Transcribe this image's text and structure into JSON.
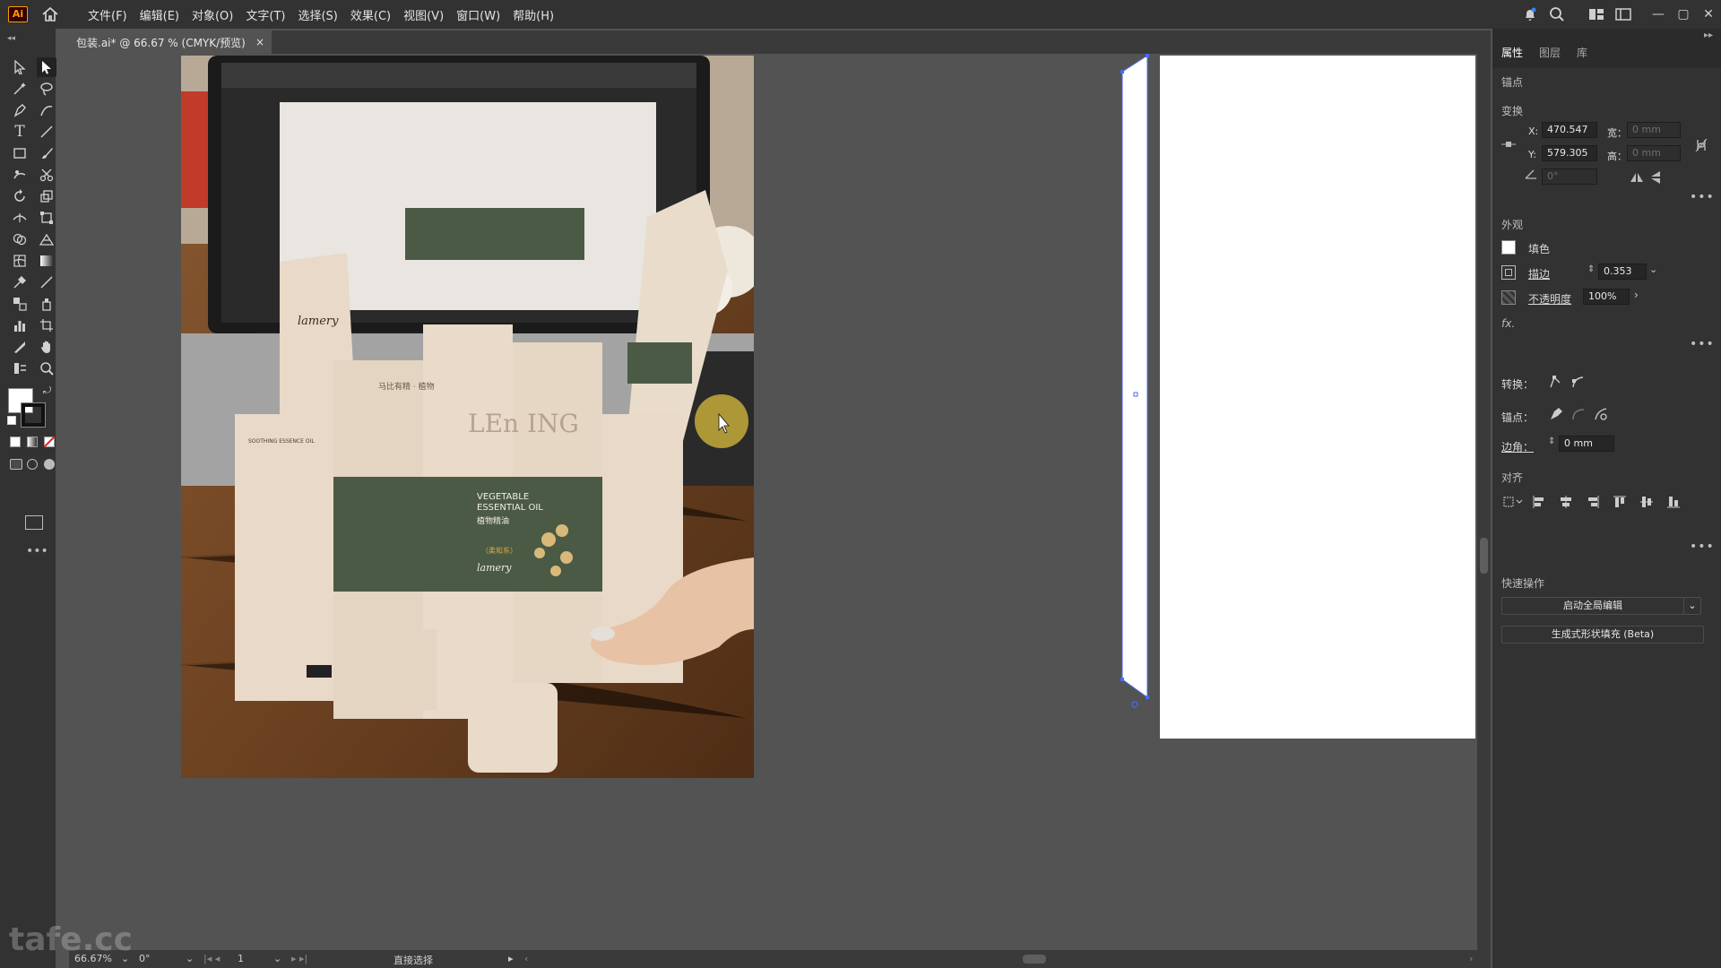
{
  "app": {
    "logo_text": "Ai"
  },
  "menu": [
    "文件(F)",
    "编辑(E)",
    "对象(O)",
    "文字(T)",
    "选择(S)",
    "效果(C)",
    "视图(V)",
    "窗口(W)",
    "帮助(H)"
  ],
  "window_controls": {
    "minimize": "—",
    "restore": "▢",
    "close": "✕"
  },
  "document_tab": {
    "title": "包装.ai* @ 66.67 % (CMYK/预览)",
    "close": "×"
  },
  "panel": {
    "tabs": [
      "属性",
      "图层",
      "库"
    ],
    "selection_type": "锚点",
    "transform": {
      "title": "变换",
      "x_label": "X:",
      "x_value": "470.547",
      "y_label": "Y:",
      "y_value": "579.305",
      "w_label": "宽：",
      "w_value": "0 mm",
      "h_label": "高：",
      "h_value": "0 mm",
      "angle_value": "0°"
    },
    "appearance": {
      "title": "外观",
      "fill_label": "填色",
      "stroke_label": "描边",
      "stroke_value": "0.353",
      "opacity_label": "不透明度",
      "opacity_value": "100%",
      "fx_label": "fx."
    },
    "convert_label": "转换：",
    "anchor_label": "锚点：",
    "corner_label": "边角：",
    "corner_value": "0 mm",
    "align_title": "对齐",
    "quick_actions": {
      "title": "快速操作",
      "global_edit": "启动全局编辑",
      "generative_fill": "生成式形状填充 (Beta)"
    },
    "more": "•••"
  },
  "status": {
    "zoom": "66.67%",
    "rotation": "0°",
    "artboard_num": "1",
    "tool_name": "直接选择"
  },
  "photo_text": {
    "brand_script": "lamery",
    "product_line1": "VEGETABLE",
    "product_line2": "ESSENTIAL OIL",
    "product_cn": "植物精油",
    "box_title": "LEn ING",
    "side_title": "SOOTHING ESSENCE OIL",
    "flavor": "（柔和系）"
  },
  "watermark": "tafe.cc",
  "colors": {
    "ui_dark": "#323232",
    "canvas": "#535353",
    "selection_blue": "#4a6cf0",
    "box_green": "#4b5a45",
    "box_paper": "#e8d9c8"
  }
}
